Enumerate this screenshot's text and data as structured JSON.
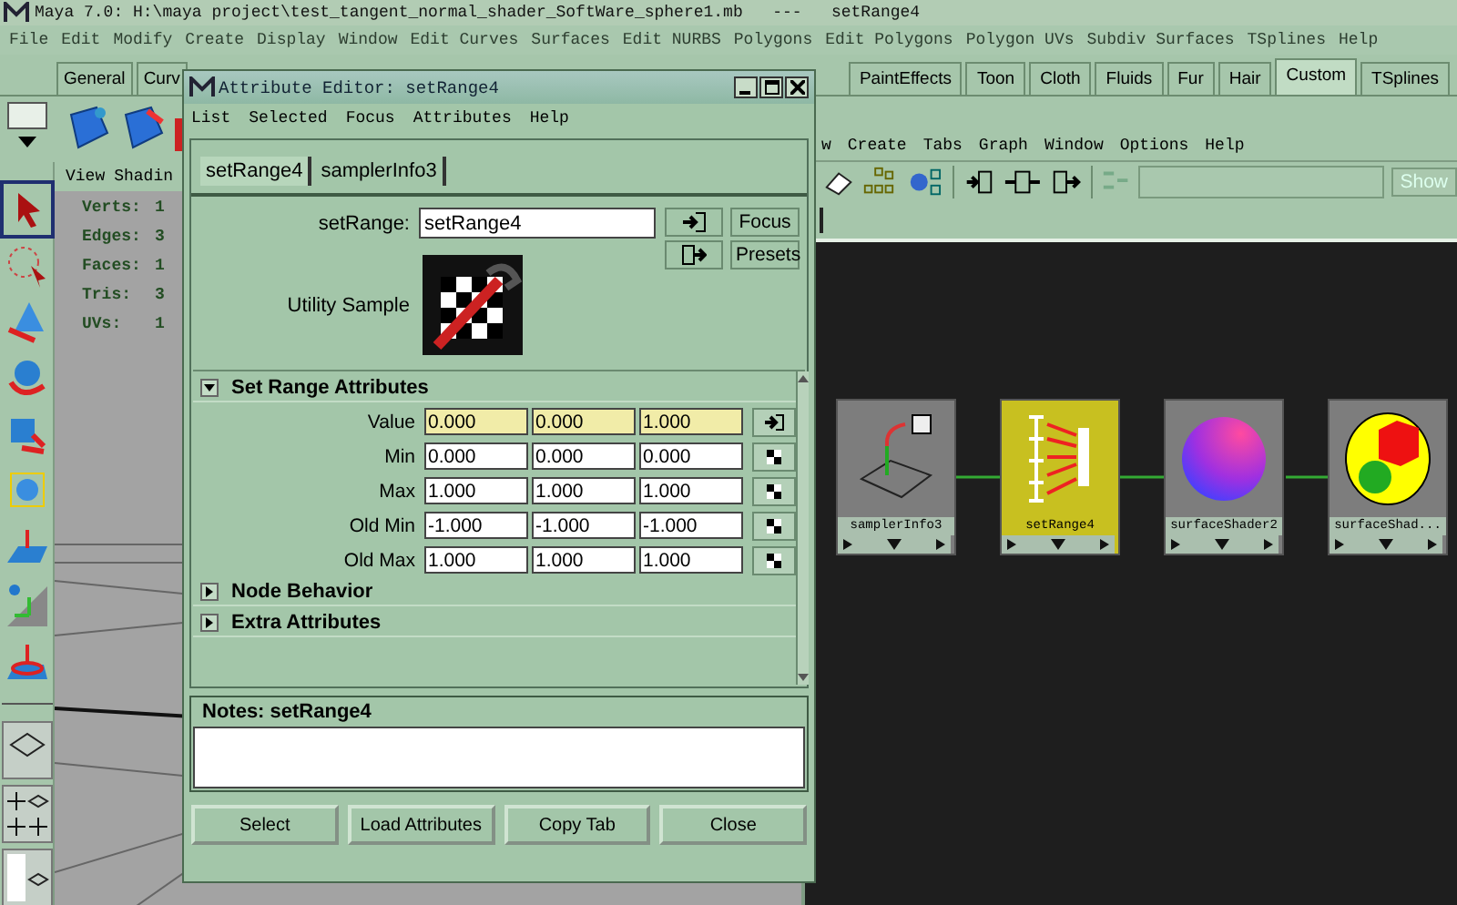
{
  "window": {
    "title": "Maya 7.0: H:\\maya project\\test_tangent_normal_shader_SoftWare_sphere1.mb   ---   setRange4"
  },
  "menu": [
    "File",
    "Edit",
    "Modify",
    "Create",
    "Display",
    "Window",
    "Edit Curves",
    "Surfaces",
    "Edit NURBS",
    "Polygons",
    "Edit Polygons",
    "Polygon UVs",
    "Subdiv Surfaces",
    "TSplines",
    "Help"
  ],
  "shelf": {
    "tabs_left": [
      {
        "label": "General",
        "selected": false
      },
      {
        "label": "Curv",
        "selected": false
      }
    ],
    "tabs_right": [
      {
        "label": "PaintEffects",
        "selected": false
      },
      {
        "label": "Toon",
        "selected": false
      },
      {
        "label": "Cloth",
        "selected": false
      },
      {
        "label": "Fluids",
        "selected": false
      },
      {
        "label": "Fur",
        "selected": false
      },
      {
        "label": "Hair",
        "selected": false
      },
      {
        "label": "Custom",
        "selected": true
      },
      {
        "label": "TSplines",
        "selected": false
      }
    ]
  },
  "viewport": {
    "menu": [
      "View",
      "Shadin"
    ],
    "stats": [
      {
        "label": "Verts:",
        "value": "1"
      },
      {
        "label": "Edges:",
        "value": "3"
      },
      {
        "label": "Faces:",
        "value": "1"
      },
      {
        "label": "Tris:",
        "value": "3"
      },
      {
        "label": "UVs:",
        "value": "1"
      }
    ]
  },
  "hypershade": {
    "menu": [
      "w",
      "Create",
      "Tabs",
      "Graph",
      "Window",
      "Options",
      "Help"
    ],
    "show_button": "Show",
    "nodes": [
      {
        "name": "samplerInfo3",
        "kind": "sampler",
        "selected": false
      },
      {
        "name": "setRange4",
        "kind": "range",
        "selected": true
      },
      {
        "name": "surfaceShader2",
        "kind": "shader",
        "selected": false
      },
      {
        "name": "surfaceShad...",
        "kind": "group",
        "selected": false
      }
    ]
  },
  "editor": {
    "title": "Attribute Editor: setRange4",
    "menu": [
      "List",
      "Selected",
      "Focus",
      "Attributes",
      "Help"
    ],
    "tabs": [
      {
        "label": "setRange4",
        "selected": true
      },
      {
        "label": "samplerInfo3",
        "selected": false
      }
    ],
    "node_field": {
      "label": "setRange:",
      "value": "setRange4"
    },
    "side_buttons": [
      "Focus",
      "Presets"
    ],
    "sample_label": "Utility Sample",
    "sections": [
      {
        "title": "Set Range Attributes",
        "expanded": true,
        "rows": [
          {
            "label": "Value",
            "values": [
              "0.000",
              "0.000",
              "1.000"
            ],
            "connected": true
          },
          {
            "label": "Min",
            "values": [
              "0.000",
              "0.000",
              "0.000"
            ],
            "connected": false
          },
          {
            "label": "Max",
            "values": [
              "1.000",
              "1.000",
              "1.000"
            ],
            "connected": false
          },
          {
            "label": "Old Min",
            "values": [
              "-1.000",
              "-1.000",
              "-1.000"
            ],
            "connected": false
          },
          {
            "label": "Old Max",
            "values": [
              "1.000",
              "1.000",
              "1.000"
            ],
            "connected": false
          }
        ]
      },
      {
        "title": "Node Behavior",
        "expanded": false
      },
      {
        "title": "Extra Attributes",
        "expanded": false
      }
    ],
    "notes_title": "Notes: setRange4",
    "buttons": [
      "Select",
      "Load Attributes",
      "Copy Tab",
      "Close"
    ]
  }
}
